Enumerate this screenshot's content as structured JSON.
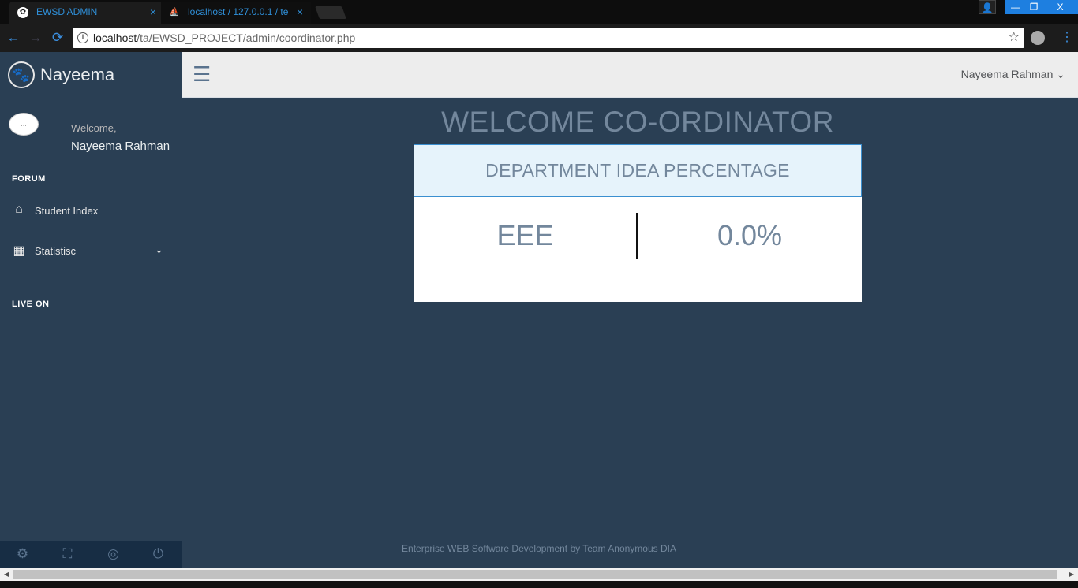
{
  "browser": {
    "tabs": [
      {
        "label": "EWSD ADMIN",
        "favicon": "paw-icon"
      },
      {
        "label": "localhost / 127.0.0.1 / te",
        "favicon": "phpmyadmin-icon"
      }
    ],
    "tab_close": "×",
    "url_host": "localhost",
    "url_path": "/ta/EWSD_PROJECT/admin/coordinator.php",
    "back": "←",
    "forward": "→",
    "reload": "⟳",
    "star": "☆",
    "menu": "⋮",
    "window_min": "—",
    "window_max": "❐",
    "window_close": "X",
    "window_user": "👤",
    "info": "i"
  },
  "sidebar": {
    "brand_icon": "🐾",
    "brand": "Nayeema",
    "welcome_label": "Welcome,",
    "user_name": "Nayeema Rahman",
    "profile_alt": "...",
    "section_forum": "FORUM",
    "items": [
      {
        "label": "Student Index",
        "icon": "home-icon",
        "glyph": "⌂"
      },
      {
        "label": "Statistisc",
        "icon": "table-icon",
        "glyph": "▦",
        "chevron": "⌄"
      }
    ],
    "section_live": "LIVE ON",
    "footer": [
      {
        "icon": "gear-icon",
        "glyph": "⚙"
      },
      {
        "icon": "fullscreen-icon",
        "glyph": "⛶"
      },
      {
        "icon": "eye-slash-icon",
        "glyph": "◎"
      },
      {
        "icon": "power-icon",
        "glyph": "⏻"
      }
    ]
  },
  "topnav": {
    "menu_glyph": "☰",
    "user": "Nayeema Rahman ⌄"
  },
  "main": {
    "title": "WELCOME CO-ORDINATOR",
    "panel_title": "DEPARTMENT IDEA PERCENTAGE",
    "department": "EEE",
    "percentage": "0.0%"
  },
  "footer": "Enterprise WEB Software Development by Team Anonymous DIA",
  "colors": {
    "sidebar": "#2a3f54",
    "topnav": "#ededed",
    "accent_text": "#73879c",
    "panel_head_bg": "#e6f3fb"
  }
}
